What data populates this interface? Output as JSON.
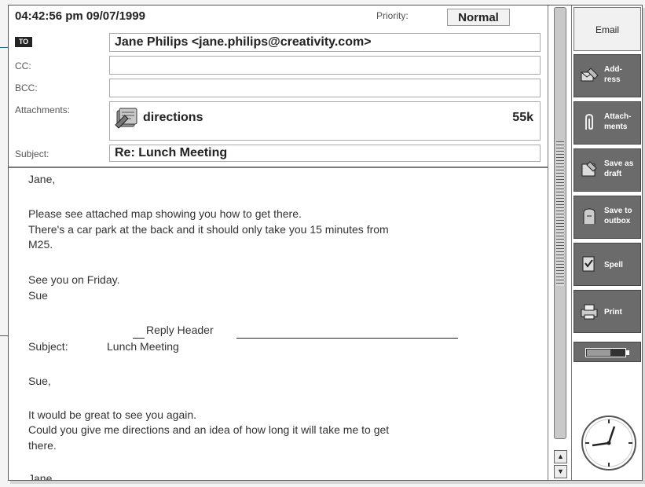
{
  "header": {
    "timestamp": "04:42:56 pm 09/07/1999",
    "priority_label": "Priority:",
    "priority_value": "Normal"
  },
  "fields": {
    "to_chip": "TO",
    "to_value": "Jane Philips <jane.philips@creativity.com>",
    "cc_label": "CC:",
    "cc_value": "",
    "bcc_label": "BCC:",
    "bcc_value": "",
    "attachments_label": "Attachments:",
    "attachment_name": "directions",
    "attachment_size": "55k",
    "subject_label": "Subject:",
    "subject_value": "Re: Lunch Meeting"
  },
  "body": {
    "greeting": "Jane,",
    "line1": "Please see attached map showing you how to get there.",
    "line2": "There's a car park at the back and it should only take you 15 minutes from",
    "line3": "M25.",
    "signoff": "See you on Friday.",
    "signature": "Sue",
    "reply_header": "Reply Header",
    "reply_subject_label": "Subject:",
    "reply_subject_value": "Lunch Meeting",
    "reply_greeting": "Sue,",
    "reply_line1": "It would be great to see you again.",
    "reply_line2": "Could you give me directions and an idea of how long it will take me to get",
    "reply_line3": "there.",
    "reply_cutoff": "Jane"
  },
  "scrollbar": {
    "up_arrow": "▲",
    "down_arrow": "▼"
  },
  "sidebar": {
    "title": "Email",
    "buttons": [
      {
        "label": "Add-\nress",
        "icon": "address-book-icon"
      },
      {
        "label": "Attach-\nments",
        "icon": "paperclip-icon"
      },
      {
        "label": "Save as\ndraft",
        "icon": "save-draft-icon"
      },
      {
        "label": "Save to\noutbox",
        "icon": "outbox-icon"
      },
      {
        "label": "Spell",
        "icon": "spell-check-icon"
      },
      {
        "label": "Print",
        "icon": "printer-icon"
      }
    ],
    "battery_icon": "battery-icon",
    "clock_icon": "analog-clock-icon"
  },
  "colors": {
    "callout_line": "#1a6a88",
    "command_button": "#6b6b6b"
  }
}
